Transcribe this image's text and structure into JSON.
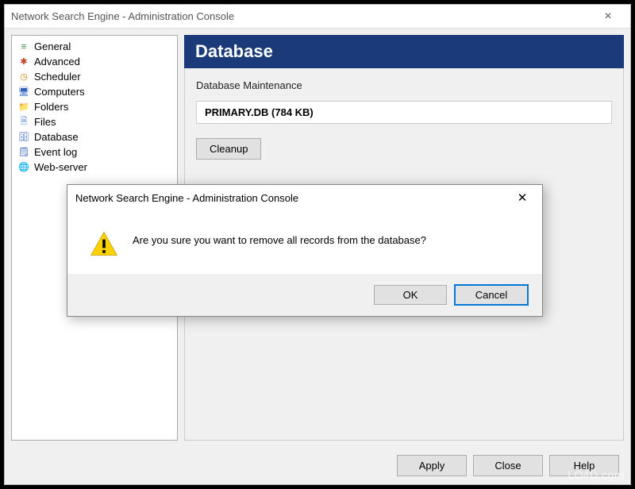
{
  "window": {
    "title": "Network Search Engine - Administration Console"
  },
  "sidebar": {
    "items": [
      {
        "label": "General",
        "icon_color": "#2a8a2a",
        "glyph": "≡"
      },
      {
        "label": "Advanced",
        "icon_color": "#c04020",
        "glyph": "✱"
      },
      {
        "label": "Scheduler",
        "icon_color": "#c08000",
        "glyph": "◷"
      },
      {
        "label": "Computers",
        "icon_color": "#3060c0",
        "glyph": "🖥"
      },
      {
        "label": "Folders",
        "icon_color": "#d8a030",
        "glyph": "📁"
      },
      {
        "label": "Files",
        "icon_color": "#5080d0",
        "glyph": "🗎"
      },
      {
        "label": "Database",
        "icon_color": "#3060c0",
        "glyph": "🗄"
      },
      {
        "label": "Event log",
        "icon_color": "#3060c0",
        "glyph": "🗒"
      },
      {
        "label": "Web-server",
        "icon_color": "#2080c0",
        "glyph": "🌐"
      }
    ]
  },
  "panel": {
    "title": "Database",
    "section_label": "Database Maintenance",
    "db_info": "PRIMARY.DB (784 KB)",
    "cleanup_label": "Cleanup"
  },
  "bottom": {
    "apply": "Apply",
    "close": "Close",
    "help": "Help"
  },
  "dialog": {
    "title": "Network Search Engine - Administration Console",
    "message": "Are you sure you want to remove all records from the database?",
    "ok": "OK",
    "cancel": "Cancel"
  },
  "watermark": "LO4D.com"
}
